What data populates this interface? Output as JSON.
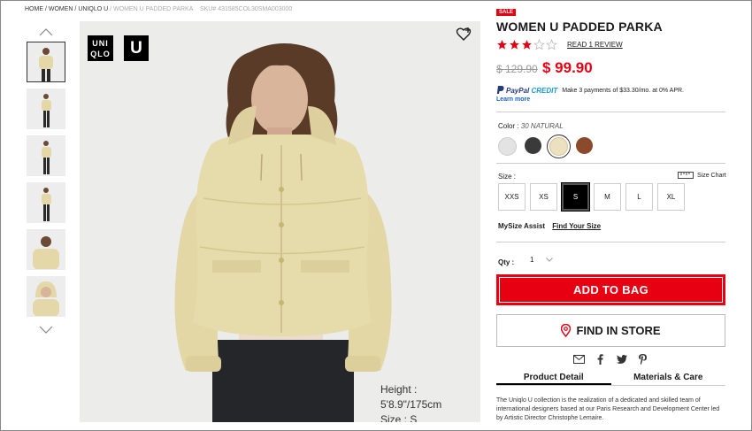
{
  "breadcrumb": {
    "home": "HOME",
    "women": "WOMEN",
    "uniqlo_u": "UNIQLO U",
    "current": "WOMEN U PADDED PARKA",
    "sku": "SKU# 431585COL30SMA003000",
    "separator": "/"
  },
  "brand": {
    "logo_text": "UNI QLO",
    "u_text": "U",
    "color": "#000000"
  },
  "model_info": {
    "height": "Height : 5'8.9\"/175cm",
    "size": "Size : S"
  },
  "product": {
    "sale_badge": "SALE",
    "title": "WOMEN U PADDED PARKA",
    "rating": 3,
    "rating_max": 5,
    "reviews_link": "READ 1 REVIEW",
    "old_price": "$ 129.90",
    "new_price": "$ 99.90",
    "price_color": "#e60012"
  },
  "paypal": {
    "logo_p1": "PayPal",
    "logo_p2": "CREDIT",
    "message": "Make 3 payments of $33.30/mo. at 0% APR.",
    "learn_more": "Learn more"
  },
  "color": {
    "label": "Color :",
    "selected": "30 NATURAL",
    "swatches": [
      {
        "name": "light-gray",
        "hex": "#e3e3e3"
      },
      {
        "name": "dark-gray",
        "hex": "#3a3a3a"
      },
      {
        "name": "natural",
        "hex": "#ede0be"
      },
      {
        "name": "brown",
        "hex": "#8b4a2b"
      }
    ]
  },
  "size": {
    "label": "Size :",
    "chart_label": "Size Chart",
    "options": [
      "XXS",
      "XS",
      "S",
      "M",
      "L",
      "XL"
    ],
    "selected": "S",
    "my_size_label": "MySize Assist",
    "find_size": "Find Your Size"
  },
  "quantity": {
    "label": "Qty :",
    "value": "1"
  },
  "actions": {
    "add_to_bag": "ADD TO BAG",
    "find_in_store": "FIND IN STORE"
  },
  "social_icons": [
    "email-icon",
    "facebook-icon",
    "twitter-icon",
    "pinterest-icon"
  ],
  "tabs": {
    "detail": "Product Detail",
    "materials": "Materials & Care"
  },
  "description": "The Uniqlo U collection is the realization of a dedicated and skilled team of international designers based at our Paris Research and Development Center led by Artistic Director Christophe Lemaire."
}
